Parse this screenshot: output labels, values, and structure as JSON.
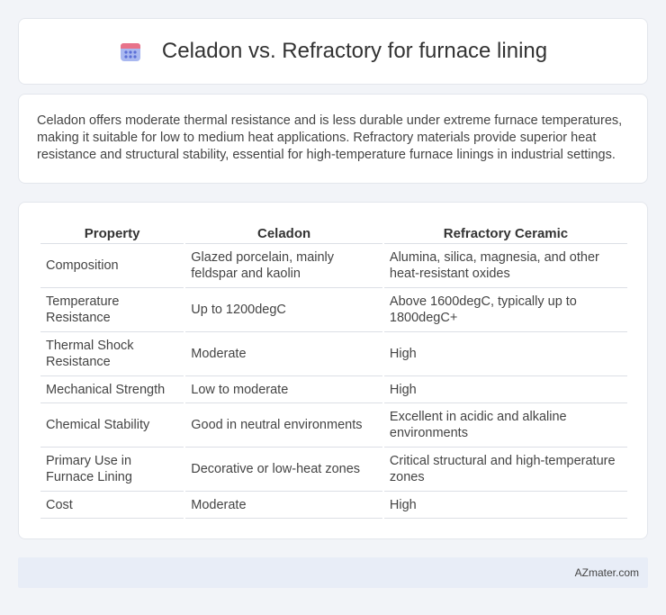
{
  "header": {
    "title": "Celadon vs. Refractory for furnace lining",
    "icon": "calendar-icon",
    "icon_colors": {
      "top": "#e8738a",
      "body": "#a9b8f0",
      "dots": "#5b6fd6"
    }
  },
  "summary": {
    "text": "Celadon offers moderate thermal resistance and is less durable under extreme furnace temperatures, making it suitable for low to medium heat applications. Refractory materials provide superior heat resistance and structural stability, essential for high-temperature furnace linings in industrial settings."
  },
  "table": {
    "headers": [
      "Property",
      "Celadon",
      "Refractory Ceramic"
    ],
    "rows": [
      [
        "Composition",
        "Glazed porcelain, mainly feldspar and kaolin",
        "Alumina, silica, magnesia, and other heat-resistant oxides"
      ],
      [
        "Temperature Resistance",
        "Up to 1200degC",
        "Above 1600degC, typically up to 1800degC+"
      ],
      [
        "Thermal Shock Resistance",
        "Moderate",
        "High"
      ],
      [
        "Mechanical Strength",
        "Low to moderate",
        "High"
      ],
      [
        "Chemical Stability",
        "Good in neutral environments",
        "Excellent in acidic and alkaline environments"
      ],
      [
        "Primary Use in Furnace Lining",
        "Decorative or low-heat zones",
        "Critical structural and high-temperature zones"
      ],
      [
        "Cost",
        "Moderate",
        "High"
      ]
    ]
  },
  "footer": {
    "brand": "AZmater.com"
  }
}
